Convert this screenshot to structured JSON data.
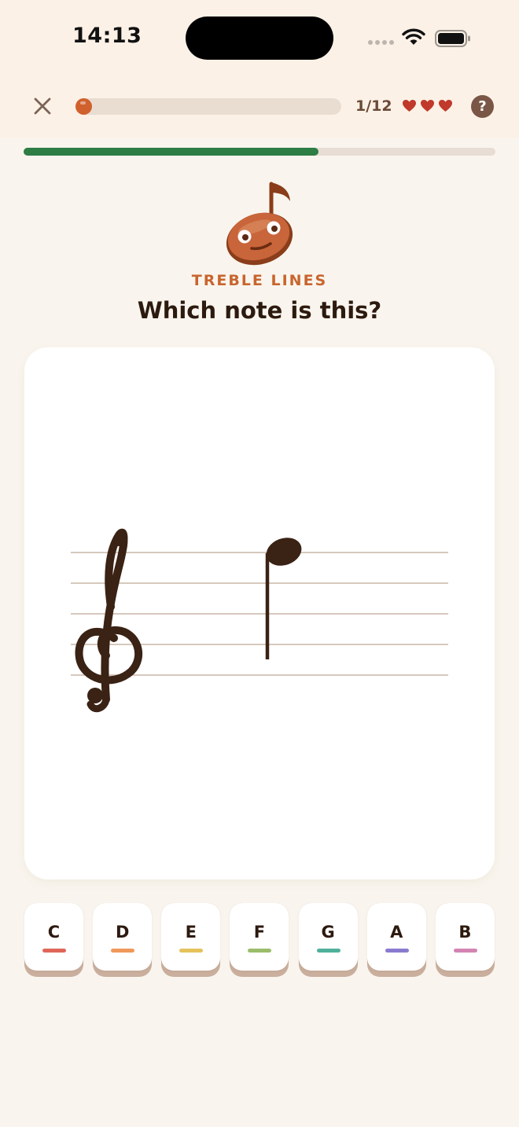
{
  "status_bar": {
    "time": "14:13"
  },
  "header": {
    "counter": "1/12",
    "lesson_progress": 0.04,
    "hearts": 3,
    "help_label": "?"
  },
  "quiz": {
    "progress": 0.625,
    "topic": "TREBLE LINES",
    "question": "Which note is this?"
  },
  "answers": [
    {
      "label": "C",
      "color": "#e0665a"
    },
    {
      "label": "D",
      "color": "#ef9a5c"
    },
    {
      "label": "E",
      "color": "#e5c25c"
    },
    {
      "label": "F",
      "color": "#9bbd6b"
    },
    {
      "label": "G",
      "color": "#4fb09c"
    },
    {
      "label": "A",
      "color": "#8b7bcf"
    },
    {
      "label": "B",
      "color": "#d384b3"
    }
  ],
  "colors": {
    "accent": "#c8652e",
    "progress_green": "#2e7d44",
    "heart": "#c0392b",
    "ink": "#3a2214"
  }
}
